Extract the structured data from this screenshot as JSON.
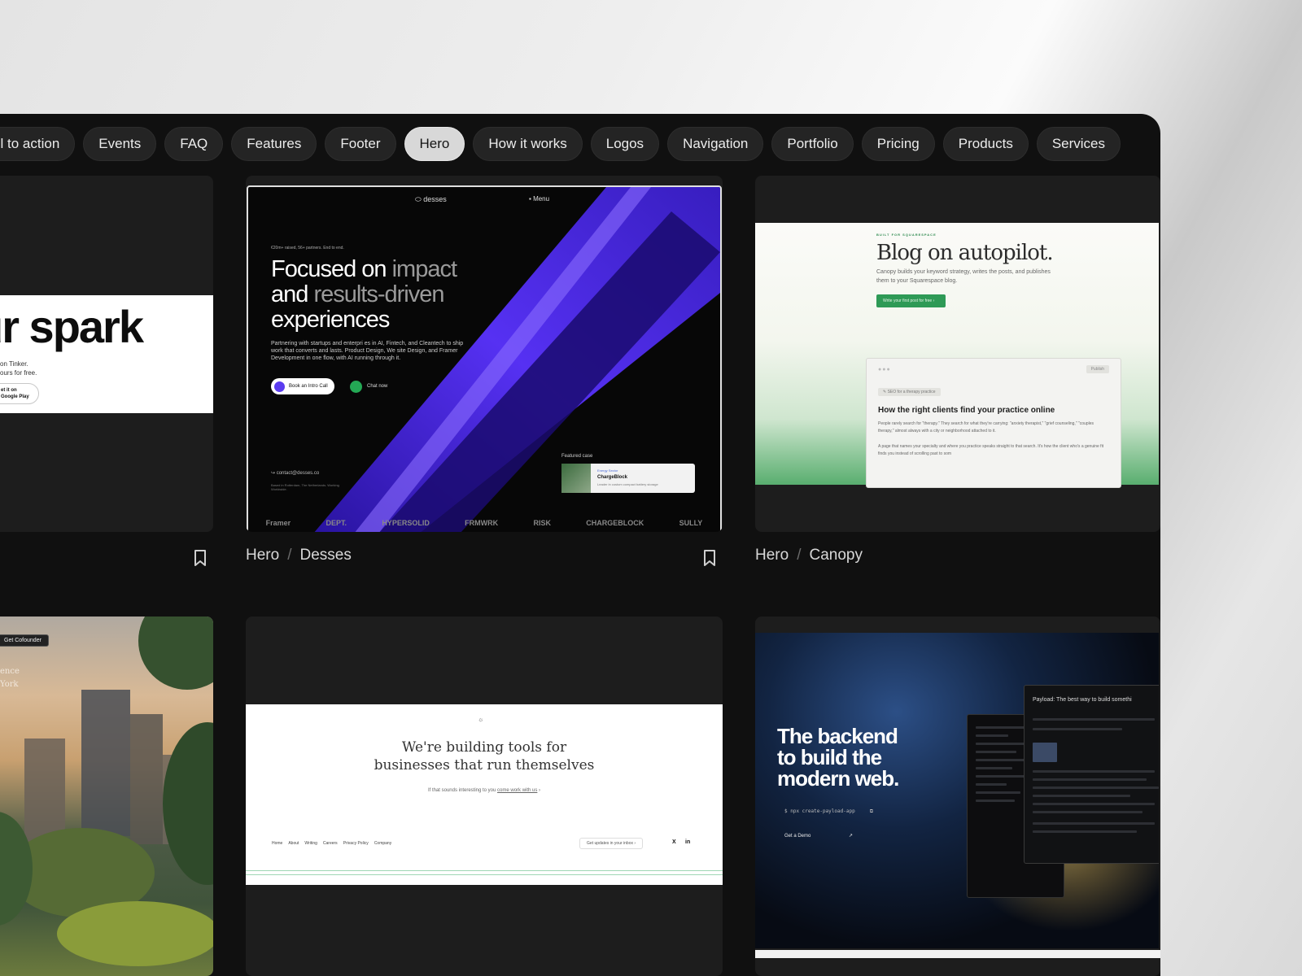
{
  "filters": [
    "Call to action",
    "Events",
    "FAQ",
    "Features",
    "Footer",
    "Hero",
    "How it works",
    "Logos",
    "Navigation",
    "Portfolio",
    "Pricing",
    "Products",
    "Services"
  ],
  "active_filter": "Hero",
  "cards": {
    "c1": {
      "headline": "ur spark",
      "line1": "on Tinker.",
      "line2": "ours for free.",
      "store_small": "et it on",
      "store_label": "Google Play"
    },
    "c2": {
      "caption_category": "Hero",
      "caption_separator": "/",
      "caption_name": "Desses",
      "logo": "desses",
      "menu": "Menu",
      "tagline": "€20m+ raised, 56+ partners. End to end.",
      "h_line1_a": "Focused on ",
      "h_line1_b": "impact",
      "h_line2_a": "and ",
      "h_line2_b": "results-driven",
      "h_line3": "experiences",
      "paragraph": "Partnering with startups and enterpri es in AI, Fintech, and Cleantech to ship work that converts and lasts. Product Design, We site Design, and Framer Development in one flow, with AI running through it.",
      "btn_primary": "Book an Intro Call",
      "btn_secondary": "Chat now",
      "contact": "contact@desses.co",
      "based": "Based in Rotterdam, The Netherlands. Working Worldwide.",
      "featured_label": "Featured case",
      "featured_sector": "Energy Sector",
      "featured_title": "ChargeBlock",
      "featured_sub": "Leader in custom compact battery storage",
      "logos": [
        "Framer",
        "DEPT.",
        "HYPERSOLID",
        "FRMWRK",
        "RISK",
        "CHARGEBLOCK",
        "SULLY"
      ]
    },
    "c3": {
      "caption_category": "Hero",
      "caption_separator": "/",
      "caption_name": "Canopy",
      "kicker": "BUILT FOR SQUARESPACE",
      "title": "Blog on autopilot.",
      "paragraph": "Canopy builds your keyword strategy, writes the posts, and publishes them to your Squarespace blog.",
      "button": "Write your first post for free",
      "publish": "Publish",
      "chip": "SEO for a therapy practice",
      "panel_title": "How the right clients find your practice online",
      "panel_p1": "People rarely search for \"therapy.\" They search for what they're carrying: \"anxiety therapist,\" \"grief counseling,\" \"couples therapy,\" almost always with a city or neighborhood attached to it.",
      "panel_p2": "A page that names your specialty and where you practice speaks straight to that search. It's how the client who's a genuine fit finds you instead of scrolling past to som"
    },
    "c4": {
      "button": "Get Cofounder",
      "text1": "ence",
      "text2": "York"
    },
    "c5": {
      "title_line1": "We're building tools for",
      "title_line2": "businesses that run themselves",
      "sub_a": "If that sounds interesting to you ",
      "sub_b": "come work with us",
      "nav": [
        "Home",
        "About",
        "Writing",
        "Careers",
        "Privacy Policy",
        "Company"
      ],
      "inbox": "Get updates in your inbox",
      "social_x": "X",
      "social_in": "in"
    },
    "c6": {
      "h_line1": "The backend",
      "h_line2": "to build the",
      "h_line3": "modern web.",
      "command": "$ npx create-payload-app",
      "demo": "Get a Demo",
      "editor_title": "Payload: The best way to build somethi"
    }
  }
}
